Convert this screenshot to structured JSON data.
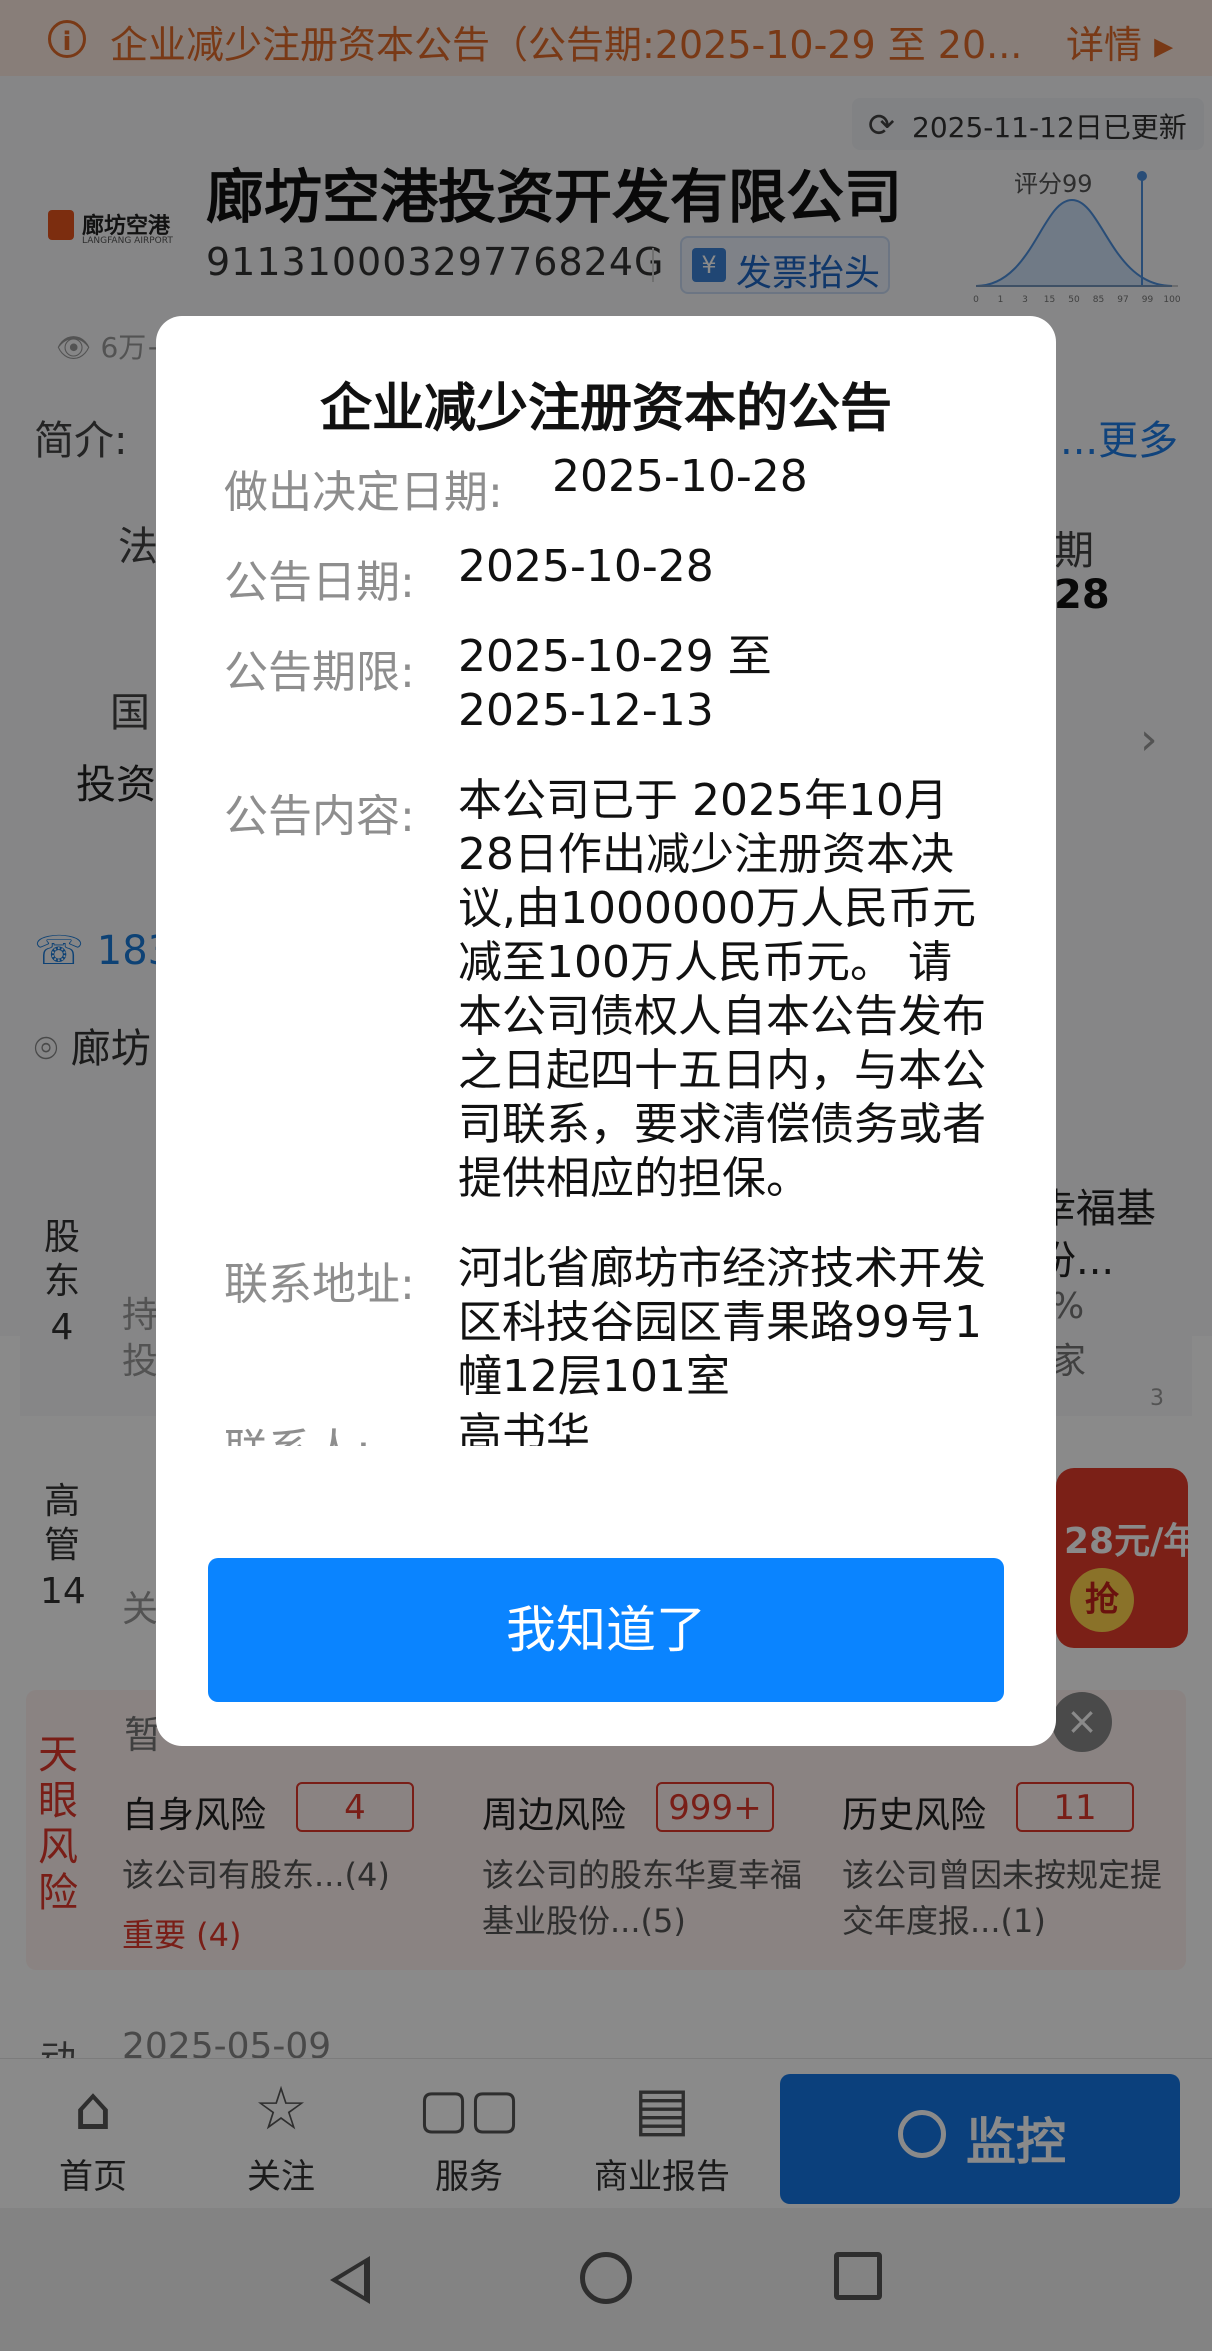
{
  "notice_bar": {
    "text": "企业减少注册资本公告（公告期:2025-10-29 至 20...",
    "more": "详情"
  },
  "header": {
    "updated": "2025-11-12日已更新",
    "logo_text": "廊坊空港",
    "logo_sub": "LANGFANG AIRPORT",
    "company_name": "廊坊空港投资开发有限公司",
    "credit_code": "91131000329776824G",
    "invoice_label": "发票抬头",
    "score_label": "评分99",
    "score_ticks": [
      "0",
      "1",
      "3",
      "15",
      "50",
      "85",
      "97",
      "99",
      "100"
    ],
    "views": "6万+"
  },
  "background": {
    "intro_label": "简介:",
    "intro_more": "...更多",
    "frag_legal": "法",
    "frag_date": "28",
    "frag_month": "期",
    "frag_state": "国",
    "frag_invest": "投资",
    "phone": "183",
    "address": "廊坊",
    "shareholder_label": "股东",
    "shareholder_count": "4",
    "shareholder_frag1": "持",
    "shareholder_frag2": "投",
    "shareholder_right1": "幸福基",
    "shareholder_right2": "份...",
    "shareholder_right3": "%",
    "shareholder_right4": "家",
    "shareholder_right5": "3",
    "exec_label": "高管",
    "exec_count": "14",
    "exec_frag": "关",
    "risk_frag": "暂",
    "dyn_label": "动",
    "dyn_date": "2025-05-09"
  },
  "promo": {
    "price": "28元/年",
    "grab": "抢"
  },
  "risk": {
    "tag": "天眼风险",
    "columns": [
      {
        "title": "自身风险",
        "count": "4",
        "desc": "该公司有股东...(4)",
        "important": "重要 (4)"
      },
      {
        "title": "周边风险",
        "count": "999+",
        "desc": "该公司的股东华夏幸福基业股份...(5)"
      },
      {
        "title": "历史风险",
        "count": "11",
        "desc": "该公司曾因未按规定提交年度报...(1)"
      }
    ]
  },
  "bottom_nav": {
    "items": [
      {
        "label": "首页",
        "icon": "home-icon"
      },
      {
        "label": "关注",
        "icon": "star-icon"
      },
      {
        "label": "服务",
        "icon": "grid-icon"
      },
      {
        "label": "商业报告",
        "icon": "report-icon"
      }
    ],
    "monitor_label": "监控"
  },
  "dialog": {
    "title": "企业减少注册资本的公告",
    "rows": [
      {
        "label": "做出决定日期:",
        "value": "2025-10-28"
      },
      {
        "label": "公告日期:",
        "value": "2025-10-28"
      },
      {
        "label": "公告期限:",
        "value": "2025-10-29 至 2025-12-13"
      },
      {
        "label": "公告内容:",
        "value": "本公司已于 2025年10月28日作出减少注册资本决议,由1000000万人民币元减至100万人民币元。 请本公司债权人自本公告发布之日起四十五日内，与本公司联系，要求清偿债务或者提供相应的担保。"
      },
      {
        "label": "联系地址:",
        "value": "河北省廊坊市经济技术开发区科技谷园区青果路99号1幢12层101室"
      },
      {
        "label": "联系人:",
        "value": "高书华"
      }
    ],
    "button": "我知道了"
  },
  "colors": {
    "accent": "#0a84ff",
    "notice_orange": "#e06a2a",
    "risk_red": "#e0382c"
  }
}
